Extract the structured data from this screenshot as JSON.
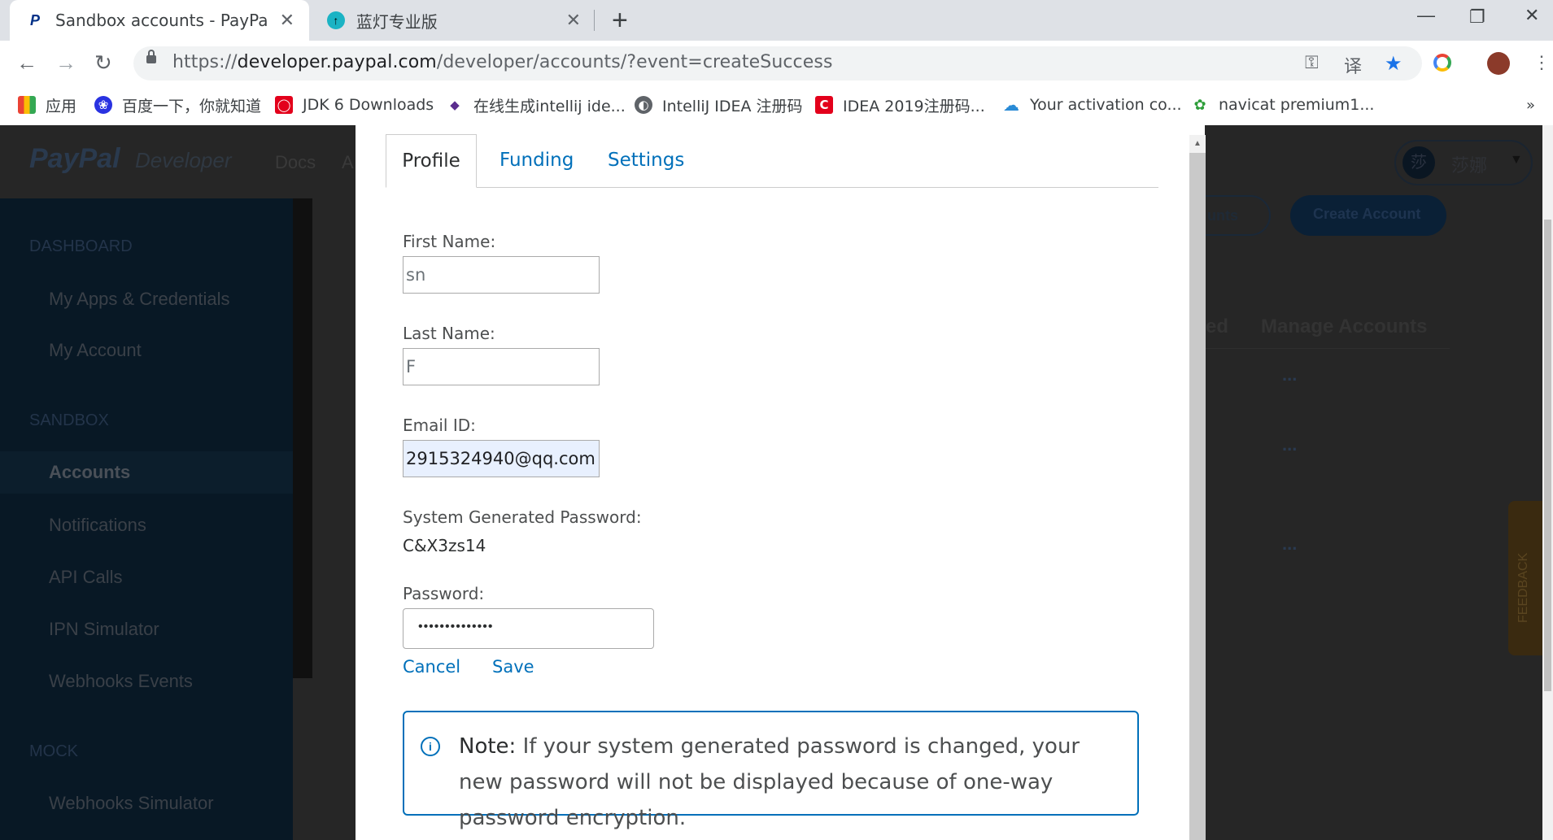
{
  "browser": {
    "tabs": [
      {
        "title": "Sandbox accounts - PayPal Developer",
        "icon": "paypal-icon",
        "active": true
      },
      {
        "title": "蓝灯专业版",
        "icon": "lantern-icon",
        "active": false
      }
    ],
    "url_prefix": "https://",
    "url_host": "developer.paypal.com",
    "url_path": "/developer/accounts/?event=createSuccess",
    "bookmarks": [
      {
        "label": "应用",
        "icon": "apps-grid-icon"
      },
      {
        "label": "百度一下，你就知道",
        "icon": "baidu-paw-icon"
      },
      {
        "label": "JDK 6 Downloads",
        "icon": "oracle-icon"
      },
      {
        "label": "在线生成intellij ide...",
        "icon": "bookmark-icon"
      },
      {
        "label": "IntelliJ IDEA 注册码",
        "icon": "globe-icon"
      },
      {
        "label": "IDEA 2019注册码...",
        "icon": "csdn-icon"
      },
      {
        "label": "Your activation co...",
        "icon": "cloud-icon"
      },
      {
        "label": "navicat premium1...",
        "icon": "leaf-icon"
      }
    ],
    "overflow": "»"
  },
  "background": {
    "logo": "PayPal",
    "logo_sub": "Developer",
    "nav_docs": "Docs",
    "nav_a": "A",
    "user_avatar": "莎",
    "user_name": "莎娜",
    "sidebar": [
      {
        "type": "head",
        "label": "DASHBOARD"
      },
      {
        "type": "item",
        "label": "My Apps & Credentials"
      },
      {
        "type": "item",
        "label": "My Account"
      },
      {
        "type": "head",
        "label": "SANDBOX"
      },
      {
        "type": "item",
        "label": "Accounts"
      },
      {
        "type": "item",
        "label": "Notifications"
      },
      {
        "type": "item",
        "label": "API Calls"
      },
      {
        "type": "item",
        "label": "IPN Simulator"
      },
      {
        "type": "item",
        "label": "Webhooks Events"
      },
      {
        "type": "head",
        "label": "MOCK"
      },
      {
        "type": "item",
        "label": "Webhooks Simulator"
      }
    ],
    "btn_accounts_partial": "unts",
    "btn_create_account": "Create Account",
    "col_partial": "ed",
    "col_manage": "Manage Accounts",
    "row_menu": "...",
    "feedback": "FEEDBACK"
  },
  "modal": {
    "tabs": [
      "Profile",
      "Funding",
      "Settings"
    ],
    "first_name_label": "First Name:",
    "first_name_value": "sn",
    "last_name_label": "Last Name:",
    "last_name_value": "F",
    "email_label": "Email ID:",
    "email_value": "2915324940@qq.com",
    "sys_pw_label": "System Generated Password:",
    "sys_pw_value": "C&X3zs14",
    "password_label": "Password:",
    "password_value": "••••••••••••••",
    "cancel": "Cancel",
    "save": "Save",
    "note_title": "Note:",
    "note_text": "If your system generated password is changed, your new password will not be displayed because of one-way password encryption."
  }
}
